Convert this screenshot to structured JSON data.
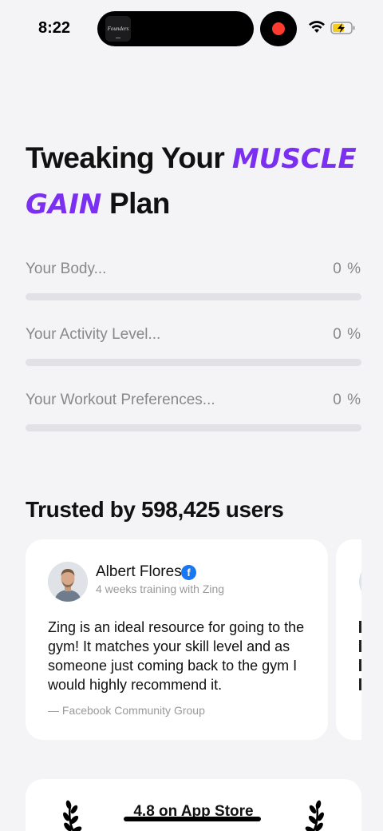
{
  "status_bar": {
    "time": "8:22",
    "island_app_label": "Founders"
  },
  "headline": {
    "part1": "Tweaking Your",
    "accent1": "Muscle",
    "accent2": "Gain",
    "part2": "Plan"
  },
  "progress": [
    {
      "label": "Your Body...",
      "value": 0,
      "percent_text": "0 %"
    },
    {
      "label": "Your Activity Level...",
      "value": 0,
      "percent_text": "0 %"
    },
    {
      "label": "Your Workout Preferences...",
      "value": 0,
      "percent_text": "0 %"
    }
  ],
  "trusted": {
    "title": "Trusted by 598,425 users"
  },
  "review": {
    "name": "Albert Flores",
    "badge": "f",
    "subtitle": "4 weeks training with Zing",
    "text": "Zing is an ideal resource for going to the gym! It matches your skill level and as someone just coming back to the gym I would highly recommend it.",
    "source": "— Facebook Community Group"
  },
  "rating": {
    "text": "4.8 on App Store"
  },
  "colors": {
    "accent": "#7b2ff0",
    "background": "#f4f4f7",
    "facebook": "#1877f2",
    "record": "#ff3b30"
  },
  "icons": [
    "wifi-icon",
    "battery-charging-icon",
    "record-icon",
    "facebook-icon",
    "laurel-left-icon",
    "laurel-right-icon"
  ]
}
